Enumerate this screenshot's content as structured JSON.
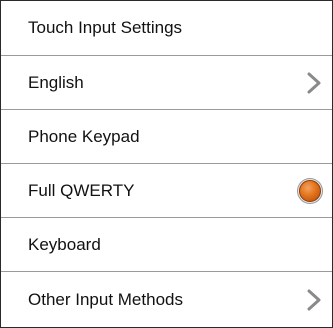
{
  "screen": {
    "title": "Touch Input Settings",
    "rows": [
      {
        "label": "English",
        "accessory": "chevron-right-icon"
      },
      {
        "label": "Phone Keypad",
        "accessory": "none"
      },
      {
        "label": "Full QWERTY",
        "accessory": "radio-selected-icon",
        "selected": true
      },
      {
        "label": "Keyboard",
        "accessory": "none"
      },
      {
        "label": "Other Input Methods",
        "accessory": "chevron-right-icon"
      }
    ]
  },
  "colors": {
    "text": "#111111",
    "divider": "#9a9a9a",
    "border": "#2a2a2a",
    "radio_fill": "#e2741b",
    "chevron": "#8a8a8a"
  }
}
